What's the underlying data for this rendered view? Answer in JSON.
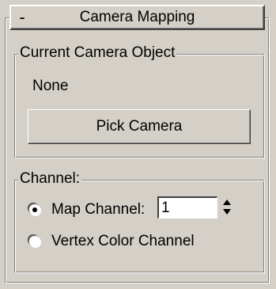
{
  "rollout": {
    "toggle": "-",
    "title": "Camera Mapping"
  },
  "camera_group": {
    "label": "Current Camera Object",
    "value": "None",
    "pick_button": "Pick Camera"
  },
  "channel_group": {
    "label": "Channel:",
    "map_channel_label": "Map Channel:",
    "map_channel_selected": true,
    "map_channel_value": "1",
    "vertex_color_label": "Vertex Color Channel",
    "vertex_color_selected": false
  },
  "icons": {
    "spinner_up": "arrow-up-icon",
    "spinner_down": "arrow-down-icon"
  }
}
